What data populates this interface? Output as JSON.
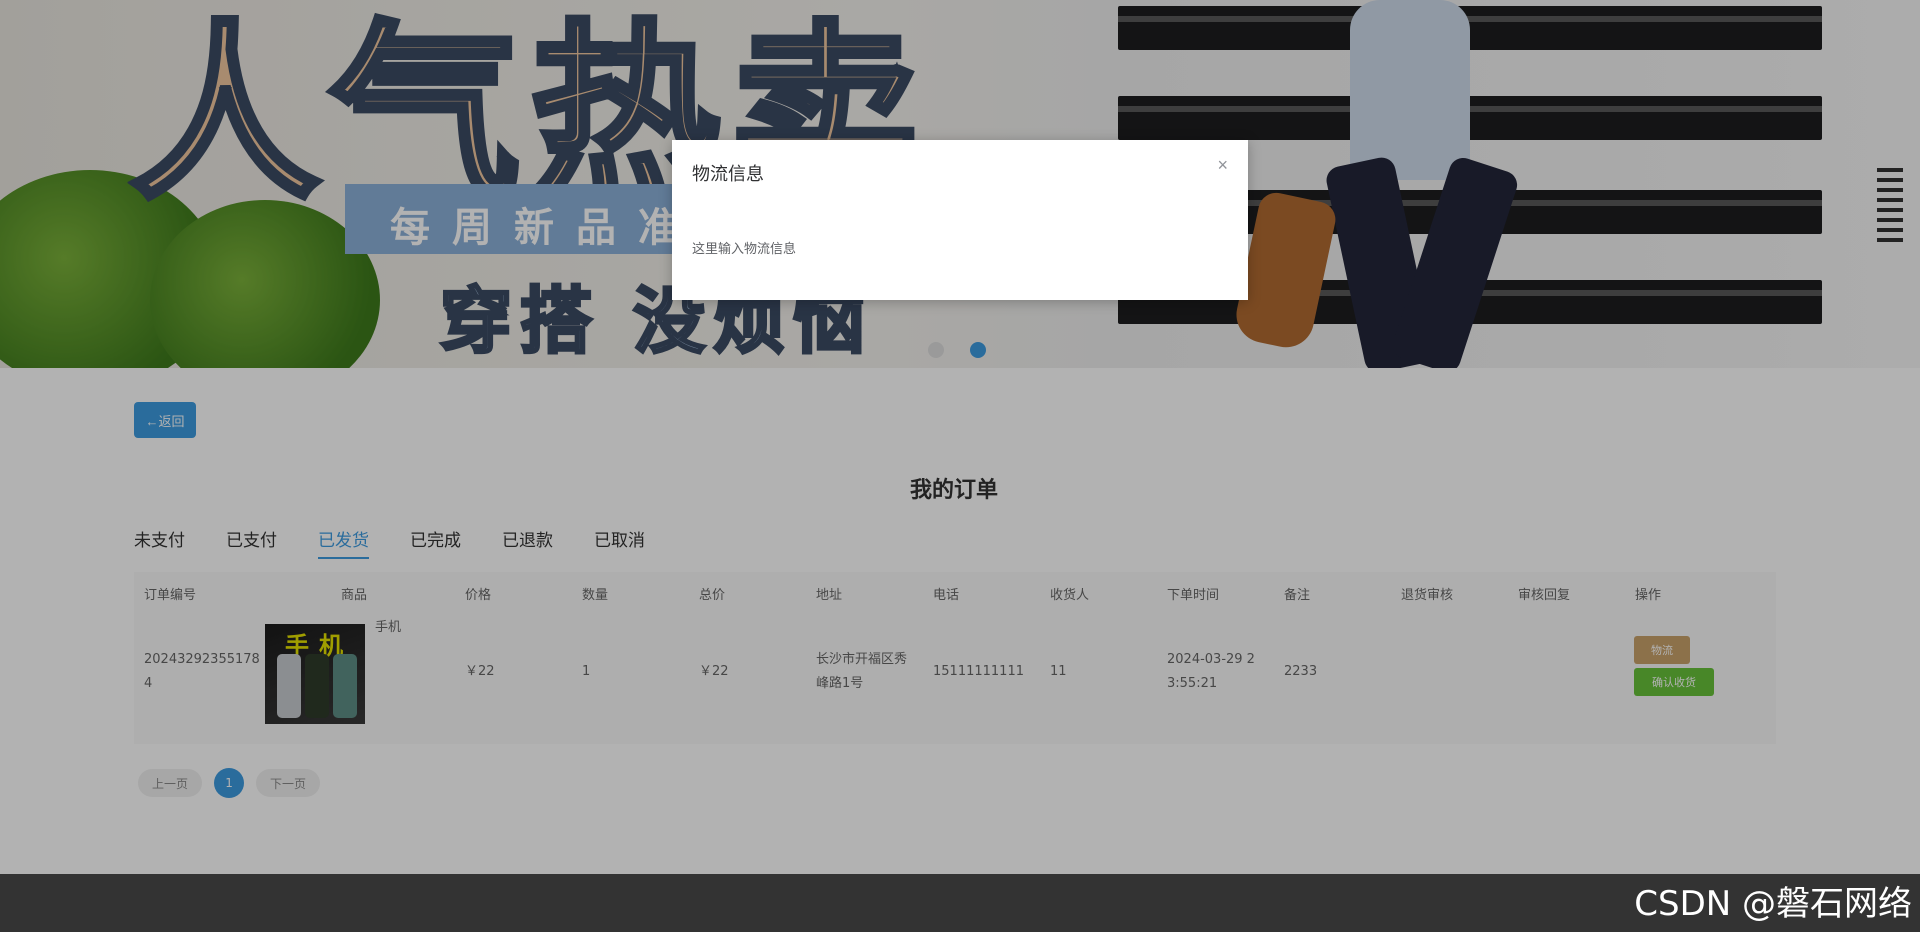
{
  "banner": {
    "headline": "人气热卖",
    "tagline": "每周新品准",
    "slogan": "穿搭 没烦恼"
  },
  "back_button": "←返回",
  "page_title": "我的订单",
  "tabs": [
    {
      "label": "未支付",
      "active": false
    },
    {
      "label": "已支付",
      "active": false
    },
    {
      "label": "已发货",
      "active": true
    },
    {
      "label": "已完成",
      "active": false
    },
    {
      "label": "已退款",
      "active": false
    },
    {
      "label": "已取消",
      "active": false
    }
  ],
  "table": {
    "headers": [
      "订单编号",
      "商品",
      "价格",
      "数量",
      "总价",
      "地址",
      "电话",
      "收货人",
      "下单时间",
      "备注",
      "退货审核",
      "审核回复",
      "操作"
    ],
    "row": {
      "order_no": "202432923551784",
      "image_label": "手机",
      "product_name": "手机",
      "price": "￥22",
      "quantity": "1",
      "total": "￥22",
      "address": "长沙市开福区秀峰路1号",
      "phone": "15111111111",
      "receiver": "11",
      "order_time": "2024-03-29 23:55:21",
      "note": "2233",
      "return_review": "",
      "review_reply": "",
      "btn_logistics": "物流",
      "btn_confirm": "确认收货"
    }
  },
  "pager": {
    "prev": "上一页",
    "current": "1",
    "next": "下一页"
  },
  "modal": {
    "title": "物流信息",
    "close": "×",
    "body": "这里输入物流信息"
  },
  "watermark": "CSDN @磐石网络",
  "colors": {
    "primary": "#3d9be0",
    "success": "#67c23a",
    "footer": "#333333"
  }
}
